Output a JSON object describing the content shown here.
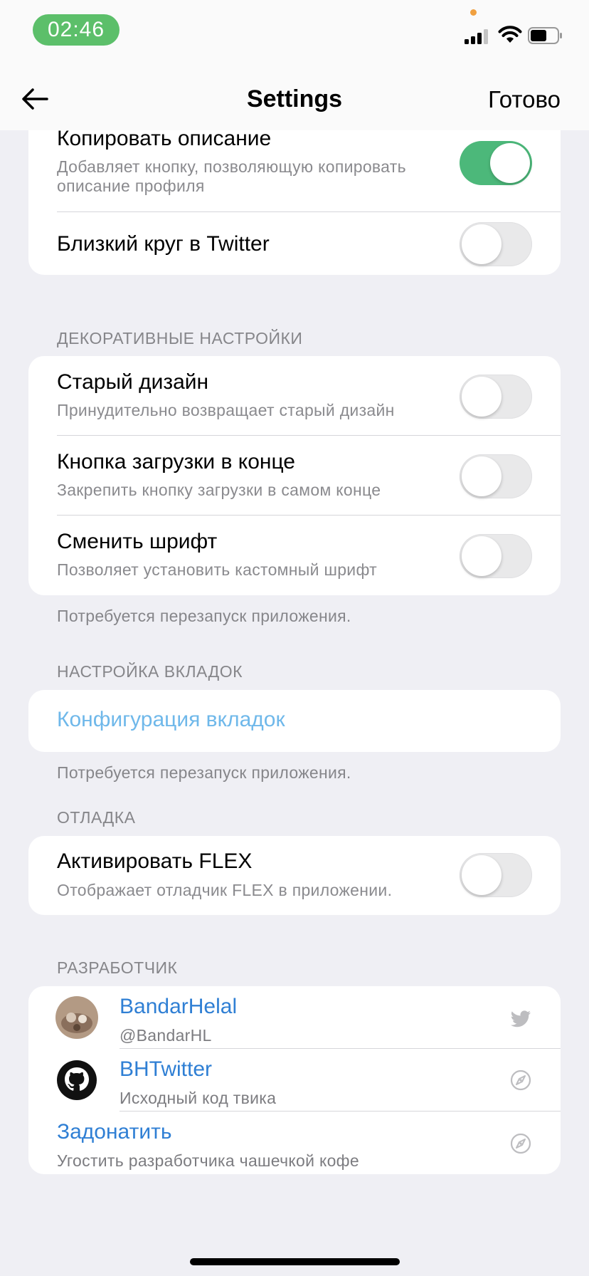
{
  "status_bar": {
    "time": "02:46"
  },
  "nav": {
    "title": "Settings",
    "done_label": "Готово"
  },
  "section1": {
    "rows": [
      {
        "title": "Копировать описание",
        "subtitle": "Добавляет кнопку, позволяющую копировать описание профиля",
        "toggle_on": true
      },
      {
        "title": "Близкий круг в Twitter",
        "toggle_on": false
      }
    ]
  },
  "decorative": {
    "header": "ДЕКОРАТИВНЫЕ НАСТРОЙКИ",
    "rows": [
      {
        "title": "Старый дизайн",
        "subtitle": "Принудительно возвращает старый дизайн",
        "toggle_on": false
      },
      {
        "title": "Кнопка загрузки в конце",
        "subtitle": "Закрепить кнопку загрузки в самом конце",
        "toggle_on": false
      },
      {
        "title": "Сменить шрифт",
        "subtitle": "Позволяет установить кастомный шрифт",
        "toggle_on": false
      }
    ],
    "footer": "Потребуется перезапуск приложения."
  },
  "tabs": {
    "header": "НАСТРОЙКА ВКЛАДОК",
    "link": "Конфигурация вкладок",
    "footer": "Потребуется перезапуск приложения."
  },
  "debug": {
    "header": "ОТЛАДКА",
    "rows": [
      {
        "title": "Активировать FLEX",
        "subtitle": "Отображает отладчик FLEX в приложении.",
        "toggle_on": false
      }
    ]
  },
  "developer": {
    "header": "РАЗРАБОТЧИК",
    "rows": [
      {
        "name": "BandarHelal",
        "subtitle": "@BandarHL",
        "icon": "twitter-bird-icon"
      },
      {
        "name": "BHTwitter",
        "subtitle": "Исходный код твика",
        "icon": "compass-icon"
      },
      {
        "name": "Задонатить",
        "subtitle": "Угостить разработчика чашечкой кофе",
        "icon": "compass-icon"
      }
    ]
  },
  "colors": {
    "toggle_on": "#4cb87a",
    "link": "#2f7fd4",
    "link_light": "#6fb8ea",
    "time_pill": "#5cbf6a",
    "background": "#efeff4"
  }
}
